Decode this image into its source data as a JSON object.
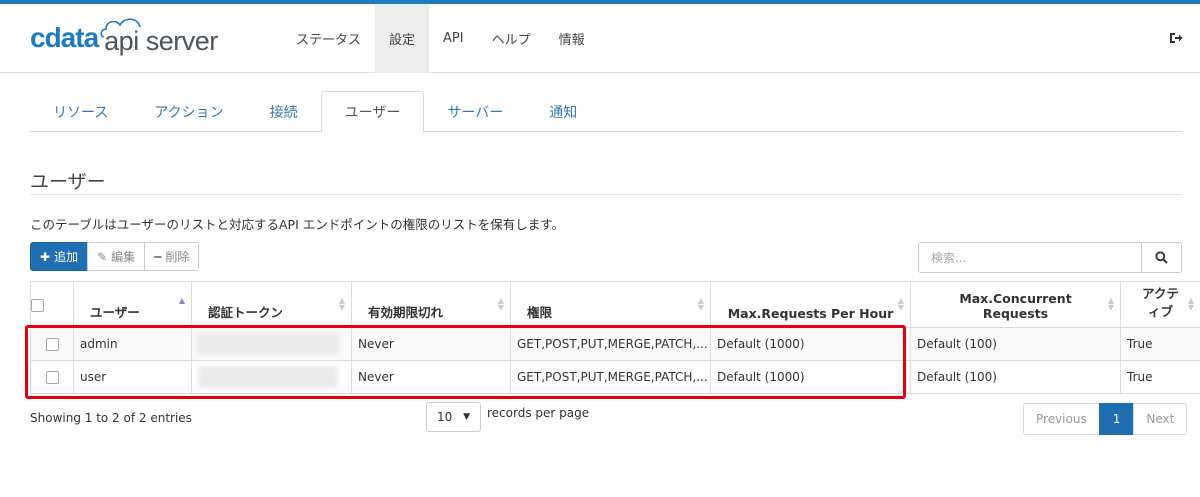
{
  "app": {
    "logo_text": "cdata",
    "logo_product": "api server"
  },
  "nav": [
    {
      "label": "ステータス"
    },
    {
      "label": "設定"
    },
    {
      "label": "API"
    },
    {
      "label": "ヘルプ"
    },
    {
      "label": "情報"
    }
  ],
  "tabs": [
    {
      "label": "リソース"
    },
    {
      "label": "アクション"
    },
    {
      "label": "接続"
    },
    {
      "label": "ユーザー"
    },
    {
      "label": "サーバー"
    },
    {
      "label": "通知"
    }
  ],
  "page": {
    "title": "ユーザー",
    "description": "このテーブルはユーザーのリストと対応するAPI エンドポイントの権限のリストを保有します。"
  },
  "toolbar": {
    "add_label": "追加",
    "edit_label": "編集",
    "delete_label": "削除"
  },
  "search": {
    "placeholder": "検索..."
  },
  "table": {
    "columns": [
      "ユーザー",
      "認証トークン",
      "有効期限切れ",
      "権限",
      "Max.Requests Per Hour",
      "Max.Concurrent Requests",
      "アクティブ"
    ],
    "column_active_line1": "アクテ",
    "column_active_line2": "ィブ",
    "rows": [
      {
        "user": "admin",
        "token": "",
        "expires": "Never",
        "permissions": "GET,POST,PUT,MERGE,PATCH,...",
        "max_requests": "Default (1000)",
        "max_concurrent": "Default (100)",
        "active": "True"
      },
      {
        "user": "user",
        "token": "",
        "expires": "Never",
        "permissions": "GET,POST,PUT,MERGE,PATCH,...",
        "max_requests": "Default (1000)",
        "max_concurrent": "Default (100)",
        "active": "True"
      }
    ]
  },
  "footer": {
    "info": "Showing 1 to 2 of 2 entries",
    "page_size": "10",
    "page_size_label": "records per page",
    "prev_label": "Previous",
    "current_page": "1",
    "next_label": "Next"
  },
  "colors": {
    "accent": "#1f6fb2",
    "highlight": "#e5000e"
  }
}
